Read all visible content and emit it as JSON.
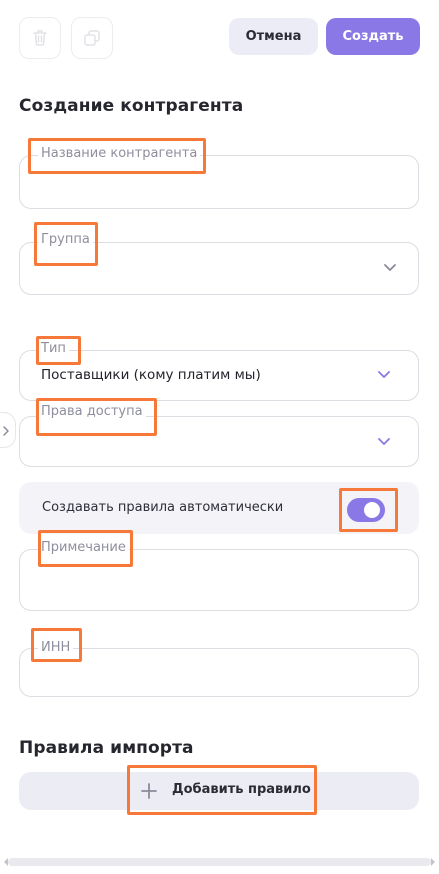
{
  "toolbar": {
    "delete_icon": "trash-icon",
    "copy_icon": "copy-icon",
    "cancel_label": "Отмена",
    "create_label": "Создать"
  },
  "form": {
    "title": "Создание контрагента",
    "fields": {
      "name": {
        "label": "Название контрагента",
        "value": ""
      },
      "group": {
        "label": "Группа",
        "value": ""
      },
      "type": {
        "label": "Тип",
        "value": "Поставщики (кому платим мы)"
      },
      "access": {
        "label": "Права доступа",
        "value": ""
      },
      "auto_rules": {
        "label": "Создавать правила автоматически",
        "enabled": true
      },
      "note": {
        "label": "Примечание",
        "value": ""
      },
      "inn": {
        "label": "ИНН",
        "value": ""
      }
    }
  },
  "import_rules": {
    "title": "Правила импорта",
    "add_label": "Добавить правило"
  },
  "colors": {
    "accent": "#8a78e6",
    "highlight": "#f6793a"
  }
}
